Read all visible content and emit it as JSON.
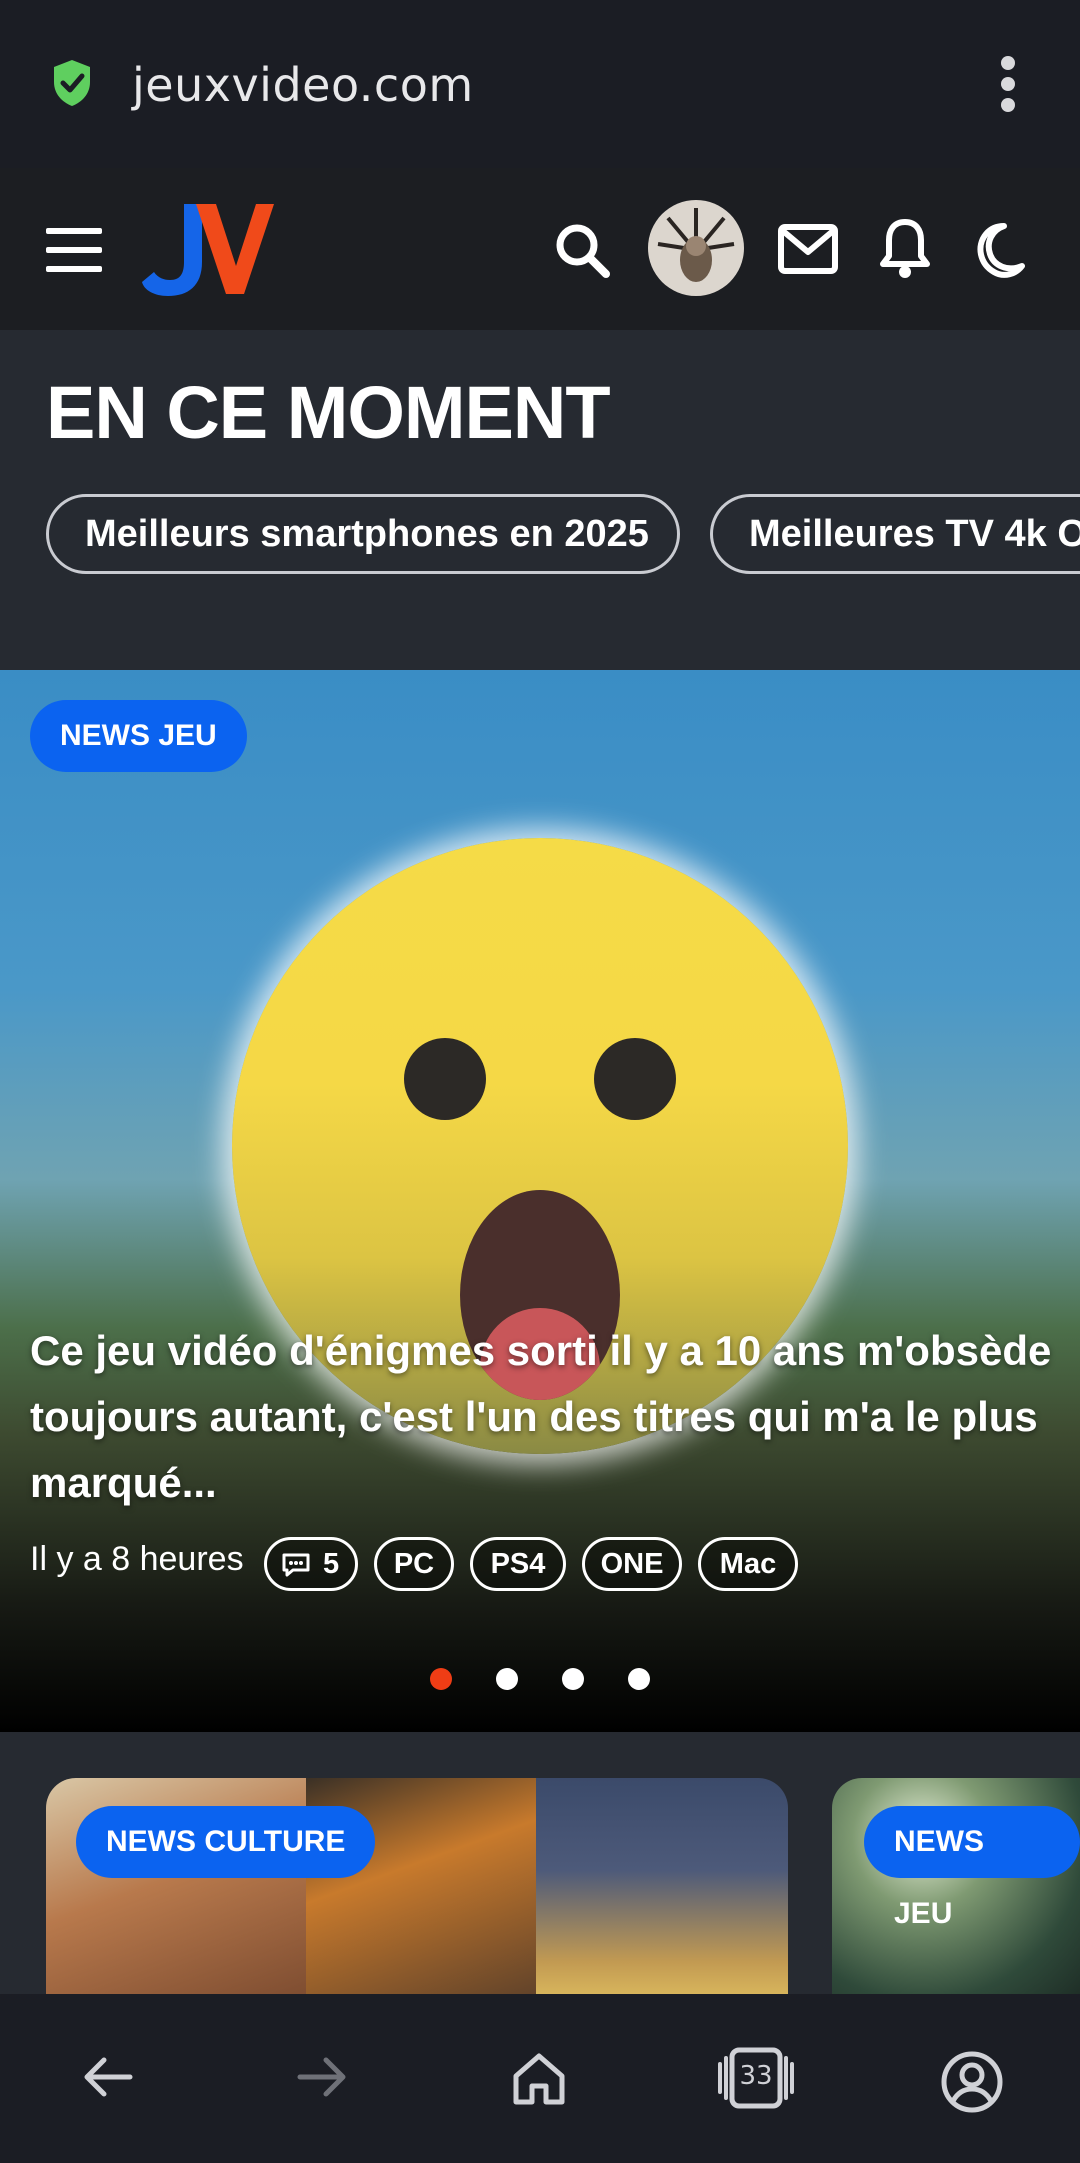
{
  "browser": {
    "url": "jeuxvideo.com",
    "tab_count": "33"
  },
  "section": {
    "heading": "EN CE MOMENT",
    "chips": [
      "Meilleurs smartphones en 2025",
      "Meilleures TV 4k O"
    ]
  },
  "hero": {
    "tag": "NEWS JEU",
    "title": "Ce jeu vidéo d'énigmes sorti il y a 10 ans m'obsède toujours autant, c'est l'un des titres qui m'a le plus marqué...",
    "time": "Il y a 8 heures",
    "comments": "5",
    "platforms": [
      "PC",
      "PS4",
      "ONE",
      "Mac"
    ],
    "carousel_total": 4,
    "carousel_active": 1
  },
  "cards": [
    {
      "tag": "NEWS CULTURE"
    },
    {
      "tag": "NEWS JEU"
    }
  ],
  "colors": {
    "accent_blue": "#0b63f0",
    "accent_red": "#ef3d15",
    "shield_green": "#5fcf5f"
  },
  "icons": [
    "shield-check-icon",
    "more-vert-icon",
    "menu-icon",
    "search-icon",
    "mail-icon",
    "bell-icon",
    "moon-icon",
    "comment-icon",
    "back-icon",
    "forward-icon",
    "home-icon",
    "tabs-icon",
    "account-icon"
  ]
}
